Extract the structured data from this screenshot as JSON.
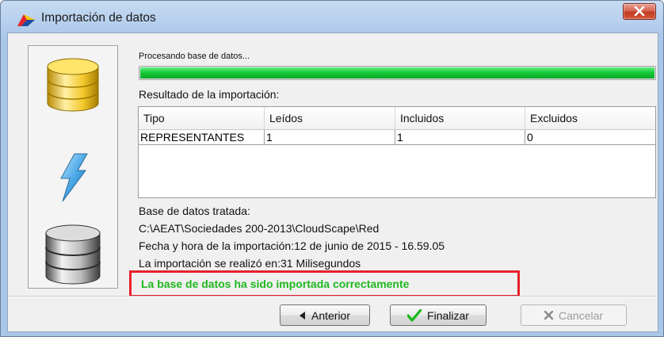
{
  "window": {
    "title": "Importación de datos"
  },
  "icons": {
    "app": "aeat-logo-icon",
    "close": "close-icon",
    "left_panel": [
      "database-yellow-icon",
      "lightning-bolt-icon",
      "database-gray-icon"
    ]
  },
  "status": {
    "processing_text": "Procesando base de datos...",
    "progress_percent": 100
  },
  "result": {
    "label": "Resultado de la importación:",
    "columns": [
      "Tipo",
      "Leídos",
      "Incluidos",
      "Excluidos"
    ],
    "rows": [
      [
        "REPRESENTANTES",
        "1",
        "1",
        "0"
      ]
    ]
  },
  "info": {
    "db_label": "Base de datos tratada:",
    "db_path": "C:\\AEAT\\Sociedades 200-2013\\CloudScape\\Red",
    "datetime": "Fecha y hora de la importación:12 de junio de 2015 - 16.59.05",
    "duration": "La importación se realizó en:31 Milisegundos",
    "success": "La base de datos ha sido importada correctamente"
  },
  "buttons": {
    "previous": "Anterior",
    "finish": "Finalizar",
    "cancel": "Cancelar"
  },
  "colors": {
    "progress": "#12c934",
    "success_text": "#1fb81f",
    "highlight": "#e8202a"
  }
}
